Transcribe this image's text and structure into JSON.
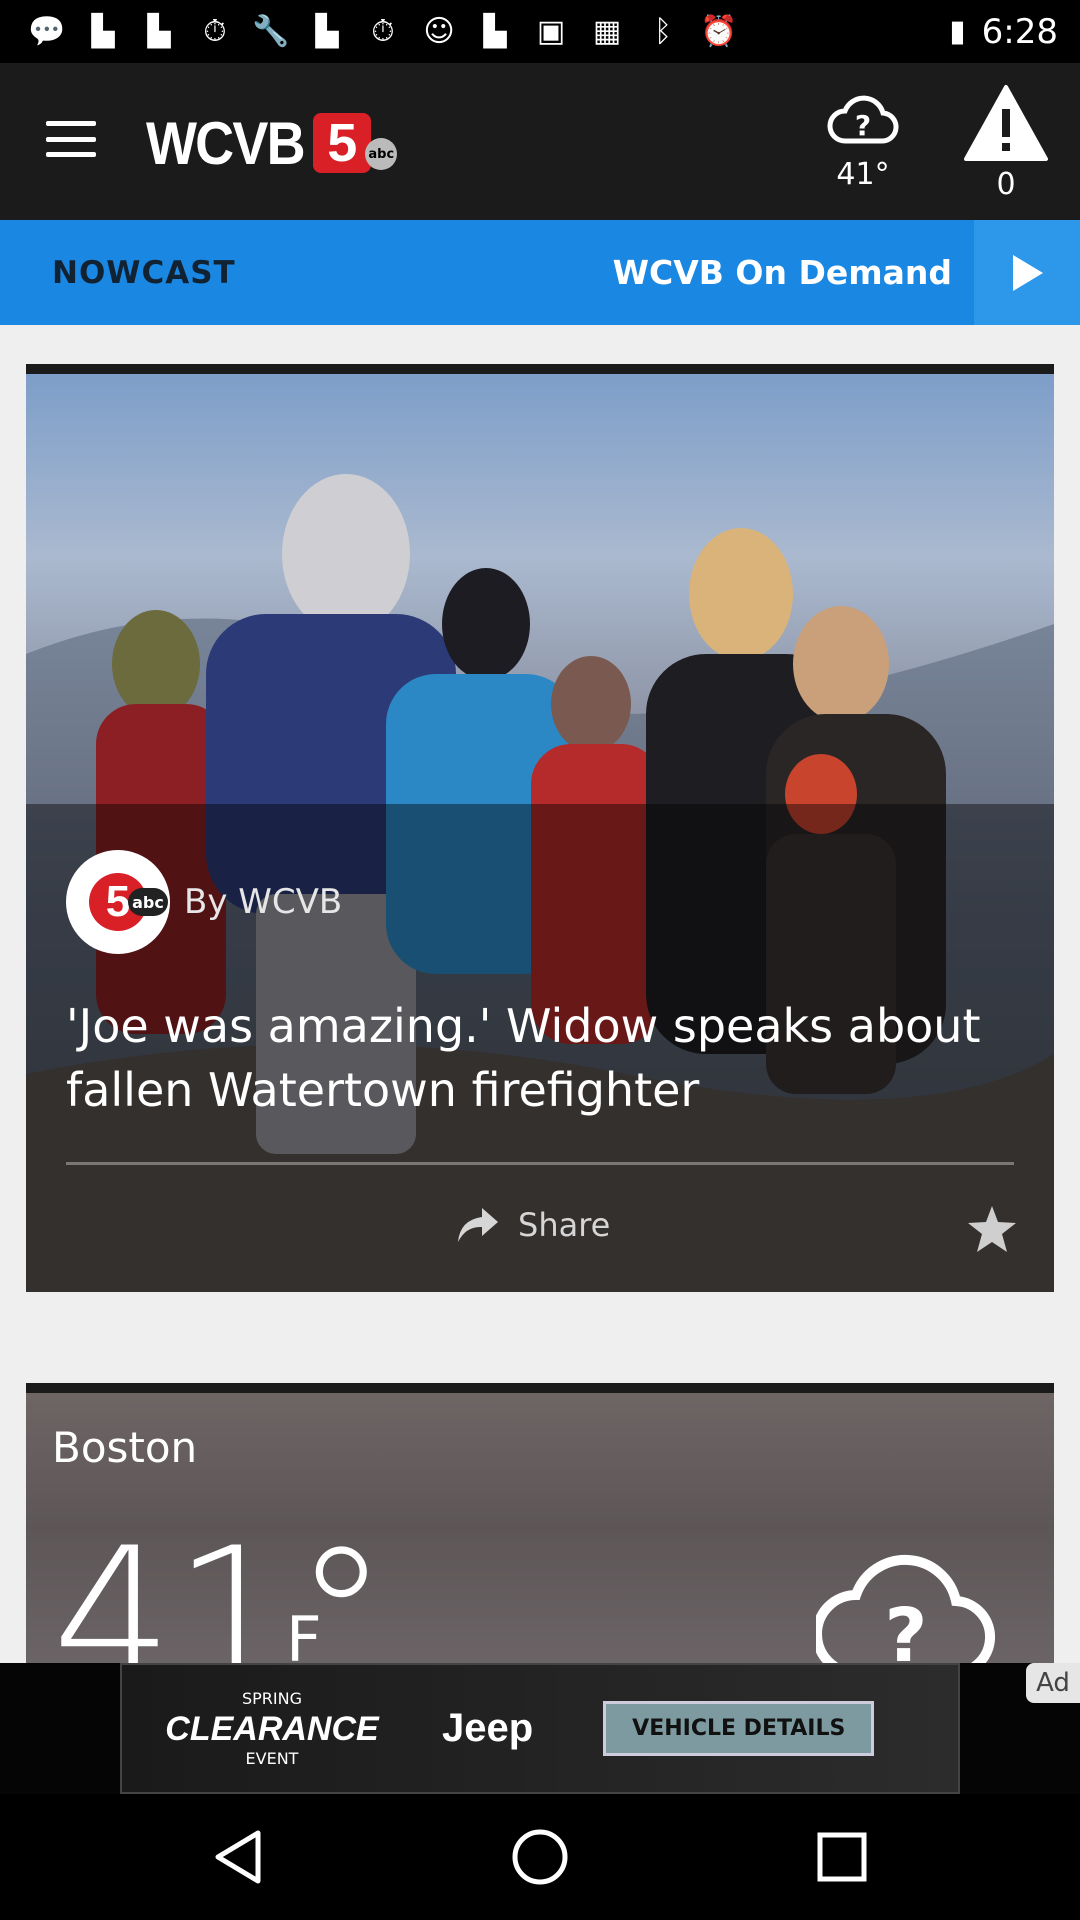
{
  "status_bar": {
    "time": "6:28",
    "left_icons": [
      "chat-icon",
      "flipboard-icon",
      "flipboard-icon",
      "stopwatch-icon",
      "wrench-icon",
      "flipboard-icon",
      "stopwatch-icon",
      "smiley-icon",
      "flipboard-icon",
      "qt-icon",
      "app-icon",
      "bluetooth-icon",
      "alarm-icon"
    ]
  },
  "header": {
    "logo_text": "WCVB",
    "logo_number": "5",
    "logo_abc": "abc",
    "weather_temp": "41°",
    "alert_count": "0"
  },
  "nav": {
    "nowcast_label": "NOWCAST",
    "on_demand_label": "WCVB On Demand"
  },
  "story": {
    "author": "By WCVB",
    "avatar_number": "5",
    "avatar_abc": "abc",
    "headline": "'Joe was amazing.' Widow speaks about fallen Watertown firefighter",
    "share_label": "Share"
  },
  "weather_card": {
    "city": "Boston",
    "temperature": "41°",
    "unit": "F"
  },
  "ad": {
    "line1": "SPRING",
    "line2": "CLEARANCE",
    "line3": "EVENT",
    "brand": "Jeep",
    "cta": "VEHICLE DETAILS",
    "label": "Ad"
  },
  "colors": {
    "accent": "#1a88e3",
    "header_bg": "#1b1b1b",
    "brand_red": "#d92027"
  }
}
